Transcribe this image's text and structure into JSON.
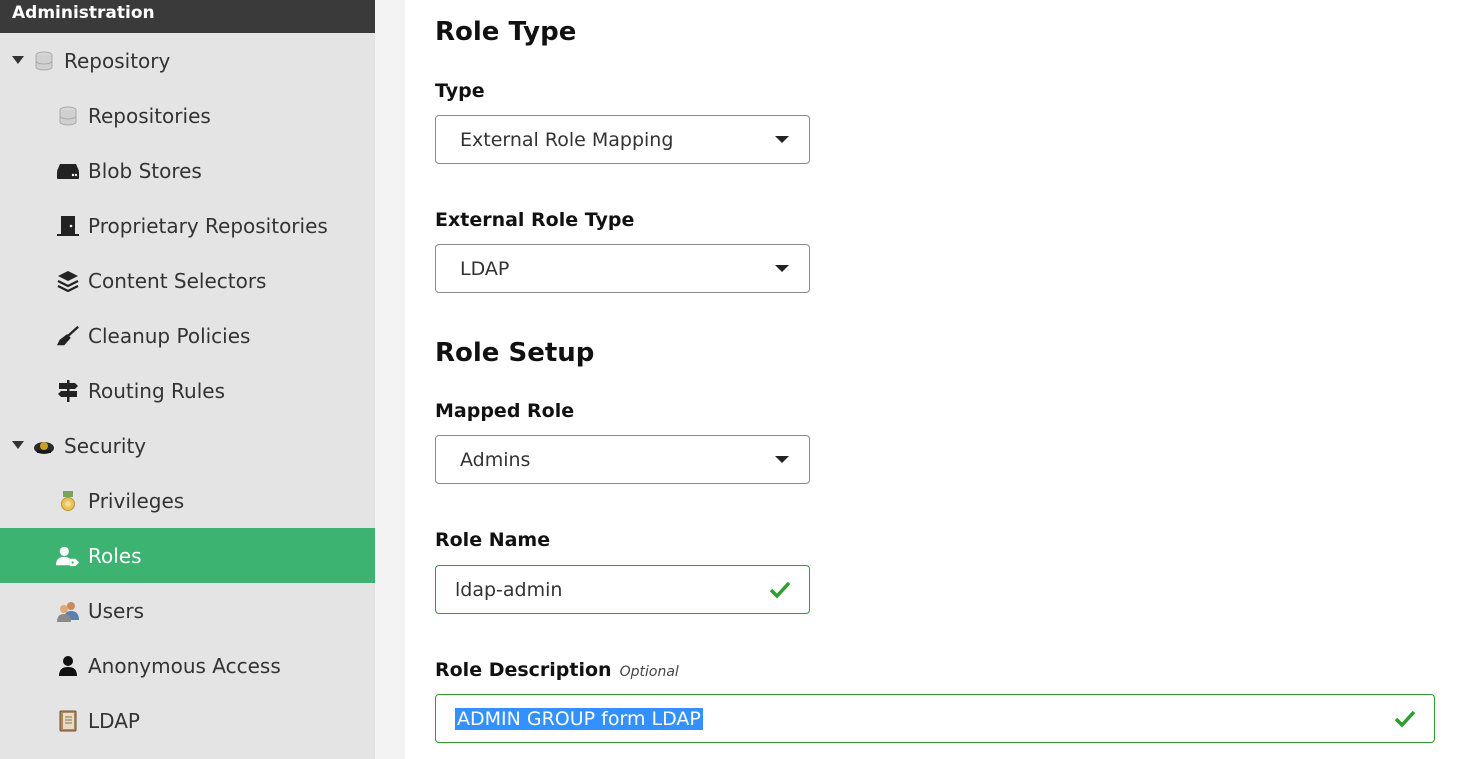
{
  "sidebar": {
    "header": "Administration",
    "groups": {
      "repository": {
        "label": "Repository",
        "icon": "database-icon"
      },
      "security": {
        "label": "Security",
        "icon": "police-hat-icon"
      }
    },
    "items": [
      {
        "label": "Repositories",
        "icon": "database-icon"
      },
      {
        "label": "Blob Stores",
        "icon": "hard-drive-icon"
      },
      {
        "label": "Proprietary Repositories",
        "icon": "door-icon"
      },
      {
        "label": "Content Selectors",
        "icon": "layers-icon"
      },
      {
        "label": "Cleanup Policies",
        "icon": "broom-icon"
      },
      {
        "label": "Routing Rules",
        "icon": "signpost-icon"
      },
      {
        "label": "Privileges",
        "icon": "medal-icon"
      },
      {
        "label": "Roles",
        "icon": "user-tag-icon",
        "active": true
      },
      {
        "label": "Users",
        "icon": "users-icon"
      },
      {
        "label": "Anonymous Access",
        "icon": "user-icon"
      },
      {
        "label": "LDAP",
        "icon": "address-book-icon"
      }
    ]
  },
  "form": {
    "role_type_title": "Role Type",
    "type_label": "Type",
    "type_value": "External Role Mapping",
    "external_role_type_label": "External Role Type",
    "external_role_type_value": "LDAP",
    "role_setup_title": "Role Setup",
    "mapped_role_label": "Mapped Role",
    "mapped_role_value": "Admins",
    "role_name_label": "Role Name",
    "role_name_value": "ldap-admin",
    "role_description_label": "Role Description",
    "role_description_optional": "Optional",
    "role_description_value": "ADMIN GROUP form LDAP"
  },
  "colors": {
    "active_bg": "#3cb371",
    "valid_border": "#2e9e2e",
    "selection": "#3390ff",
    "sidebar_header": "#3a3a3a"
  }
}
